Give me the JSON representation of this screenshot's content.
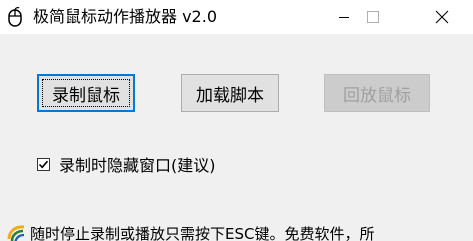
{
  "window": {
    "title": "极简鼠标动作播放器 v2.0",
    "icon": "mouse-icon"
  },
  "controls": {
    "minimize_icon": "minimize-icon",
    "maximize_icon": "maximize-icon",
    "close_icon": "close-icon"
  },
  "buttons": {
    "record_label": "录制鼠标",
    "load_script_label": "加载脚本",
    "playback_label": "回放鼠标"
  },
  "options": {
    "hide_window_label": "录制时隐藏窗口(建议)",
    "hide_window_checked": true
  },
  "status": {
    "text": "随时停止录制或播放只需按下ESC键。免费软件，所",
    "icon": "info-logo-icon",
    "icon_colors": [
      "#f5a623",
      "#2e7d32",
      "#1e5fb4"
    ]
  }
}
